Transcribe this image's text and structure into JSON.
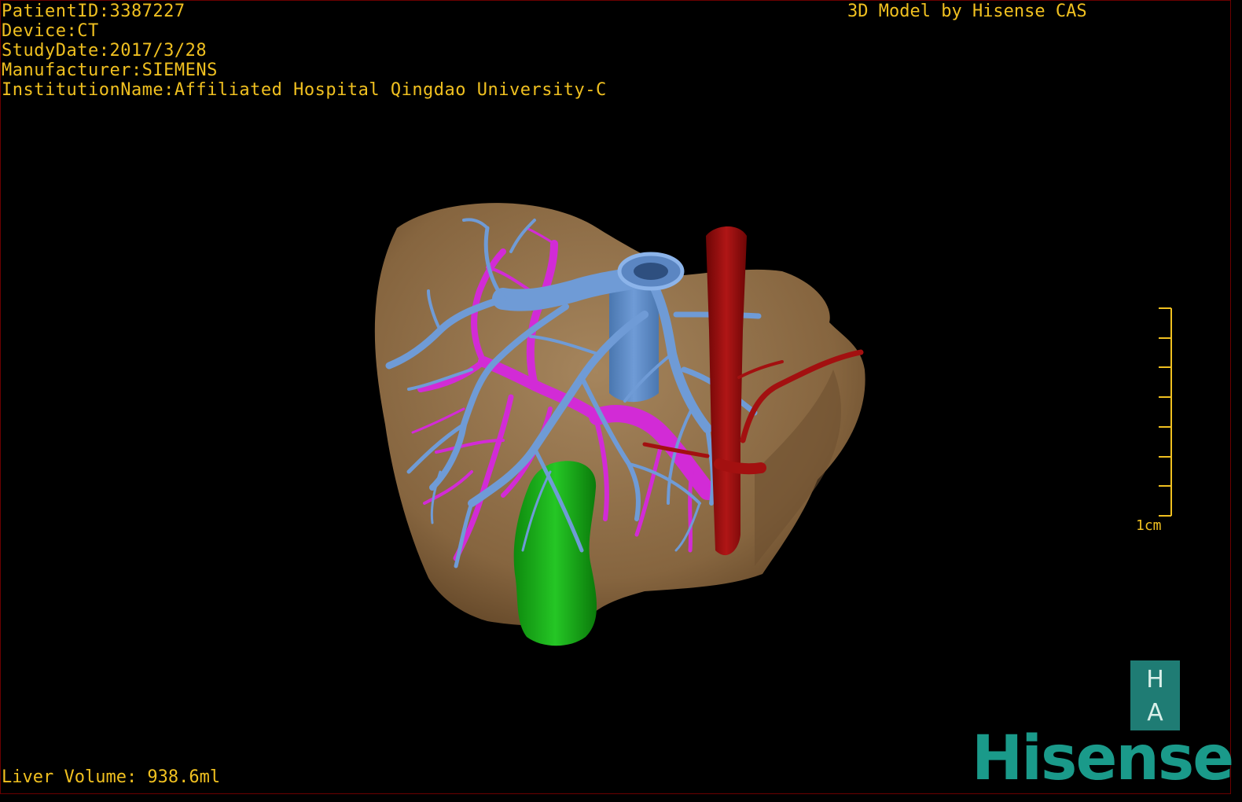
{
  "dicom_header": {
    "patient_id": "PatientID:3387227",
    "device": "Device:CT",
    "study_date": "StudyDate:2017/3/28",
    "manufacturer": "Manufacturer:SIEMENS",
    "institution": "InstitutionName:Affiliated Hospital Qingdao University-C"
  },
  "watermark": "3D Model by Hisense CAS",
  "liver_volume": "Liver Volume: 938.6ml",
  "scale_bar": {
    "label": "1cm",
    "tick_count": 7
  },
  "logo": {
    "top_letter": "H",
    "bottom_letter": "A",
    "brand": "Hisense"
  },
  "colors": {
    "text": "#f0c020",
    "liver": "#8a6a45",
    "hepatic_vein": "#6f9bd6",
    "portal_vein": "#d22bd6",
    "artery": "#9a0e0e",
    "gallbladder": "#1fb51f",
    "brand": "#1a9a8a"
  }
}
